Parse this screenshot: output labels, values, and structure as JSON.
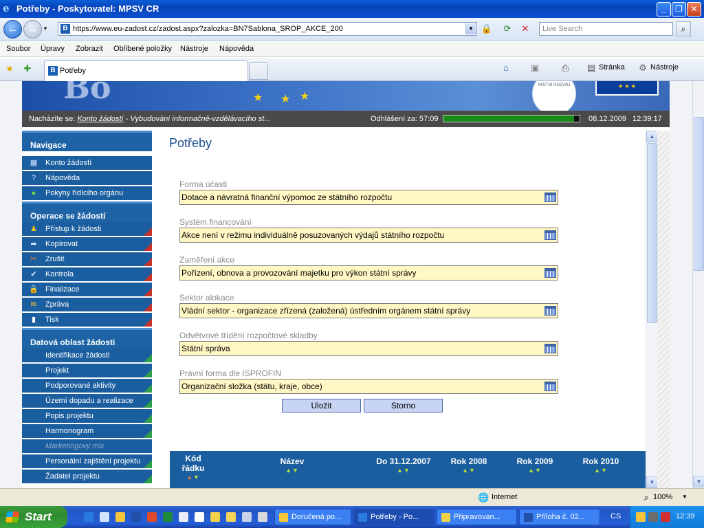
{
  "window": {
    "title": "Potřeby - Poskytovatel: MPSV CR"
  },
  "address": {
    "url": "https://www.eu-zadost.cz/zadost.aspx?zalozka=BN7Sablona_SROP_AKCE_200",
    "search_placeholder": "Live Search"
  },
  "menu": [
    "Soubor",
    "Úpravy",
    "Zobrazit",
    "Oblíbené položky",
    "Nástroje",
    "Nápověda"
  ],
  "tab": {
    "label": "Potřeby"
  },
  "commandbar": {
    "page": "Stránka",
    "tools": "Nástroje"
  },
  "banner": {
    "ministry_text": "MÍSTNÍ ROZVOJ"
  },
  "infobar": {
    "location_prefix": "Nacházíte se:",
    "location_link": "Konto žádostí",
    "location_rest": "- Vybudování informačně-vzdělávacího st...",
    "logout_label": "Odhlášení za: 57:09",
    "logout_progress_pct": 96,
    "date": "08.12.2009",
    "time": "12:39:17"
  },
  "sidebar": {
    "sections": [
      {
        "title": "Navigace",
        "items": [
          "Konto žádostí",
          "Nápověda",
          "Pokyny řídícího orgánu"
        ]
      },
      {
        "title": "Operace se žádostí",
        "items": [
          "Přístup k žádosti",
          "Kopírovat",
          "Zrušit",
          "Kontrola",
          "Finalizace",
          "Zpráva",
          "Tisk"
        ]
      },
      {
        "title": "Datová oblast žádosti",
        "items": [
          "Identifikace žádosti",
          "Projekt",
          "Podporované aktivity",
          "Území dopadu a realizace",
          "Popis projektu",
          "Harmonogram",
          "Marketingový mix",
          "Personální zajištění projektu",
          "Žadatel projektu"
        ]
      }
    ]
  },
  "content": {
    "title": "Potřeby",
    "fields": [
      {
        "label": "Forma účasti",
        "value": "Dotace a návratná finanční výpomoc ze státního rozpočtu"
      },
      {
        "label": "Systém financování",
        "value": "Akce není v režimu individuálně posuzovaných výdajů státního rozpočtu"
      },
      {
        "label": "Zaměření akce",
        "value": "Pořízení, obnova a provozování majetku pro výkon státní správy"
      },
      {
        "label": "Sektor alokace",
        "value": "Vládní sektor - organizace zřízená (založená) ústředním orgánem státní správy"
      },
      {
        "label": "Odvětvové třídění rozpočtové skladby",
        "value": "Státní správa"
      },
      {
        "label": "Právní forma dle ISPROFIN",
        "value": "Organizační složka (státu, kraje, obce)"
      }
    ],
    "save_label": "Uložit",
    "cancel_label": "Storno",
    "table": {
      "col_code_1": "Kód",
      "col_code_2": "řádku",
      "col_name": "Název",
      "col_2007": "Do 31.12.2007",
      "col_2008": "Rok 2008",
      "col_2009": "Rok 2009",
      "col_2010": "Rok 2010"
    }
  },
  "statusbar": {
    "zone": "Internet",
    "zoom": "100%"
  },
  "taskbar": {
    "start": "Start",
    "tasks": [
      "Doručená po...",
      "Potřeby - Po...",
      "Připravovan...",
      "Příloha č. 02..."
    ],
    "lang": "CS",
    "clock": "12:39"
  }
}
